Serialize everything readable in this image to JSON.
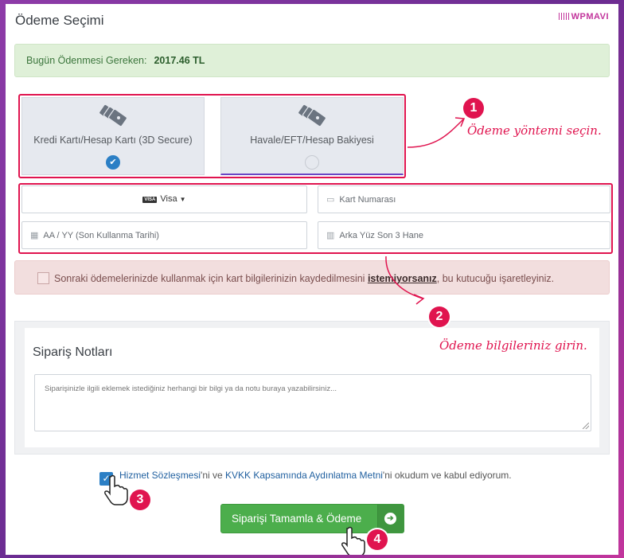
{
  "page": {
    "title": "Ödeme Seçimi",
    "brand": "WPMAVI"
  },
  "amount": {
    "label": "Bugün Ödenmesi Gereken:",
    "value": "2017.46 TL"
  },
  "payment_methods": [
    {
      "label": "Kredi Kartı/Hesap Kartı (3D Secure)",
      "selected": true,
      "icon": "cards-icon"
    },
    {
      "label": "Havale/EFT/Hesap Bakiyesi",
      "selected": false,
      "icon": "cards-icon"
    }
  ],
  "card_form": {
    "brand_badge": "VISA",
    "brand_value": "Visa",
    "card_number_placeholder": "Kart Numarası",
    "expiry_placeholder": "AA / YY (Son Kullanma Tarihi)",
    "cvv_placeholder": "Arka Yüz Son 3 Hane"
  },
  "save_card": {
    "text_before": "Sonraki ödemelerinizde kullanmak için kart bilgilerinizin kaydedilmesini ",
    "emphasis": "istemiyorsanız",
    "text_after": ", bu kutucuğu işaretleyiniz."
  },
  "notes": {
    "title": "Sipariş Notları",
    "placeholder": "Siparişinizle ilgili eklemek istediğiniz herhangi bir bilgi ya da notu buraya yazabilirsiniz..."
  },
  "terms": {
    "link1": "Hizmet Sözleşmesi",
    "mid": "'ni ve ",
    "link2": "KVKK Kapsamında Aydınlatma Metni",
    "after": "'ni okudum ve kabul ediyorum.",
    "checked": true
  },
  "submit": {
    "label": "Siparişi Tamamla & Ödeme"
  },
  "annotations": {
    "step1_num": "1",
    "step1_text": "Ödeme yöntemi seçin.",
    "step2_num": "2",
    "step2_text": "Ödeme bilgileriniz girin.",
    "step3_num": "3",
    "step4_num": "4"
  },
  "colors": {
    "annotation": "#e0144f",
    "success_bg": "#dff0d8",
    "danger_bg": "#f2dede",
    "primary": "#2b7fc5",
    "button": "#4cae4c"
  }
}
